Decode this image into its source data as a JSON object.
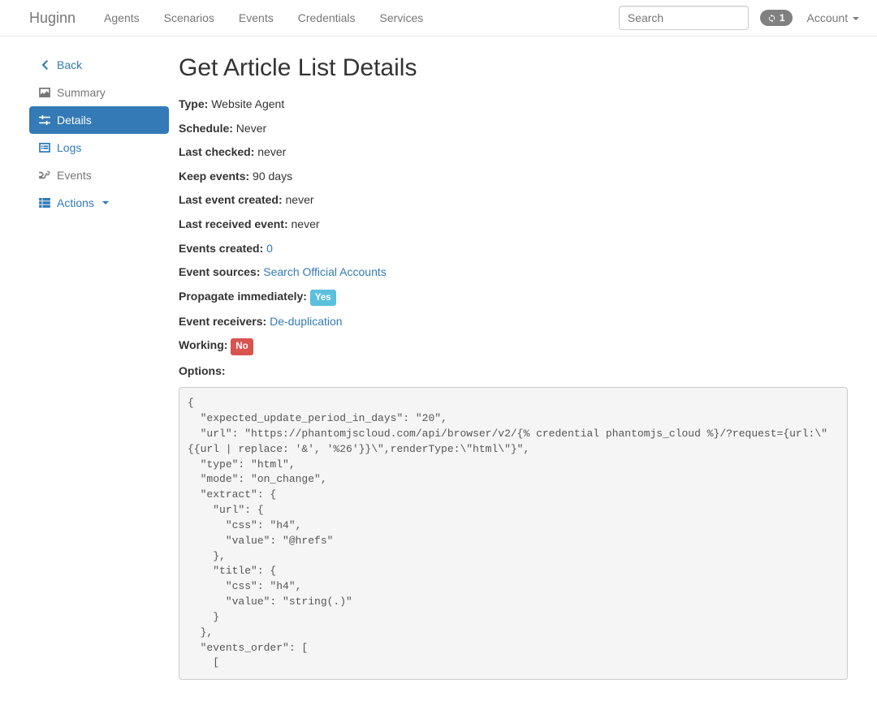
{
  "brand": "Huginn",
  "nav": {
    "links": [
      "Agents",
      "Scenarios",
      "Events",
      "Credentials",
      "Services"
    ],
    "search_placeholder": "Search",
    "badge_count": "1",
    "account_label": "Account"
  },
  "sidebar": {
    "back": "Back",
    "summary": "Summary",
    "details": "Details",
    "logs": "Logs",
    "events": "Events",
    "actions": "Actions"
  },
  "title": "Get Article List Details",
  "props": {
    "type_label": "Type:",
    "type_value": "Website Agent",
    "schedule_label": "Schedule:",
    "schedule_value": "Never",
    "lastchecked_label": "Last checked:",
    "lastchecked_value": "never",
    "keepevents_label": "Keep events:",
    "keepevents_value": "90 days",
    "lasteventcreated_label": "Last event created:",
    "lasteventcreated_value": "never",
    "lastreceived_label": "Last received event:",
    "lastreceived_value": "never",
    "eventscreated_label": "Events created:",
    "eventscreated_link": "0",
    "eventsources_label": "Event sources:",
    "eventsources_link": "Search Official Accounts",
    "propagate_label": "Propagate immediately:",
    "propagate_badge": "Yes",
    "eventreceivers_label": "Event receivers:",
    "eventreceivers_link": "De-duplication",
    "working_label": "Working:",
    "working_badge": "No",
    "options_label": "Options:"
  },
  "options_json": "{\n  \"expected_update_period_in_days\": \"20\",\n  \"url\": \"https://phantomjscloud.com/api/browser/v2/{% credential phantomjs_cloud %}/?request={url:\\\"{{url | replace: '&', '%26'}}\\\",renderType:\\\"html\\\"}\",\n  \"type\": \"html\",\n  \"mode\": \"on_change\",\n  \"extract\": {\n    \"url\": {\n      \"css\": \"h4\",\n      \"value\": \"@hrefs\"\n    },\n    \"title\": {\n      \"css\": \"h4\",\n      \"value\": \"string(.)\"\n    }\n  },\n  \"events_order\": [\n    ["
}
